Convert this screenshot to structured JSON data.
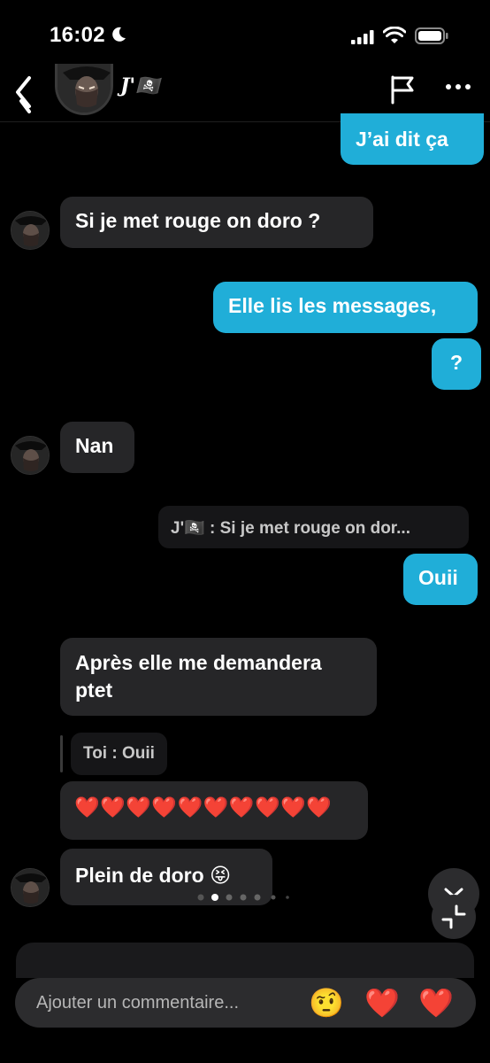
{
  "status": {
    "time": "16:02"
  },
  "header": {
    "name": "J'🏴‍☠️"
  },
  "messages": {
    "m1": "J’ai dit ça",
    "m2": "Si je met rouge on doro ?",
    "m3": "Elle lis les messages,",
    "m4": "?",
    "m5": "Nan",
    "reply1": "J'🏴‍☠️ : Si je met rouge on dor...",
    "m6": "Ouii",
    "m7_line1": "Après elle me demandera",
    "m7_line2": "ptet",
    "reply2": "Toi : Ouii",
    "m8": "❤️❤️❤️❤️❤️❤️❤️❤️❤️❤️",
    "m9": "Plein de doro 😝"
  },
  "comment": {
    "placeholder": "Ajouter un commentaire...",
    "quick_reactions": [
      "🤨",
      "❤️",
      "❤️"
    ]
  },
  "colors": {
    "accent": "#20aed8",
    "incoming": "#262628"
  },
  "icons": [
    "moon-icon",
    "signal-icon",
    "wifi-icon",
    "battery-icon",
    "back-icon",
    "flag-icon",
    "more-icon",
    "chevron-down-icon",
    "shrink-icon"
  ]
}
